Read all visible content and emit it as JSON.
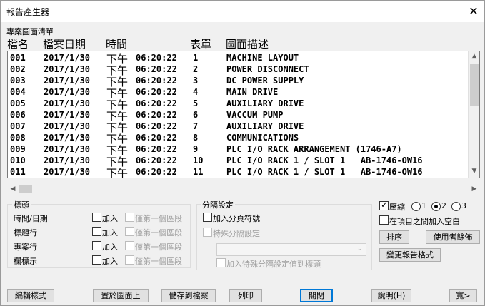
{
  "window": {
    "title": "報告產生器"
  },
  "list_section": {
    "label": "專案圖面清單",
    "columns": [
      "檔名",
      "檔案日期",
      "時間",
      "表單",
      "圖面描述"
    ],
    "rows": [
      {
        "file": "001",
        "date": "2017/1/30",
        "ampm": "下午",
        "time": "06:20:22",
        "sheet": "1",
        "desc": "MACHINE LAYOUT"
      },
      {
        "file": "002",
        "date": "2017/1/30",
        "ampm": "下午",
        "time": "06:20:22",
        "sheet": "2",
        "desc": "POWER DISCONNECT"
      },
      {
        "file": "003",
        "date": "2017/1/30",
        "ampm": "下午",
        "time": "06:20:22",
        "sheet": "3",
        "desc": "DC POWER SUPPLY"
      },
      {
        "file": "004",
        "date": "2017/1/30",
        "ampm": "下午",
        "time": "06:20:22",
        "sheet": "4",
        "desc": "MAIN DRIVE"
      },
      {
        "file": "005",
        "date": "2017/1/30",
        "ampm": "下午",
        "time": "06:20:22",
        "sheet": "5",
        "desc": "AUXILIARY DRIVE"
      },
      {
        "file": "006",
        "date": "2017/1/30",
        "ampm": "下午",
        "time": "06:20:22",
        "sheet": "6",
        "desc": "VACCUM PUMP"
      },
      {
        "file": "007",
        "date": "2017/1/30",
        "ampm": "下午",
        "time": "06:20:22",
        "sheet": "7",
        "desc": "AUXILIARY DRIVE"
      },
      {
        "file": "008",
        "date": "2017/1/30",
        "ampm": "下午",
        "time": "06:20:22",
        "sheet": "8",
        "desc": "COMMUNICATIONS"
      },
      {
        "file": "009",
        "date": "2017/1/30",
        "ampm": "下午",
        "time": "06:20:22",
        "sheet": "9",
        "desc": "PLC I/O RACK ARRANGEMENT (1746-A7)"
      },
      {
        "file": "010",
        "date": "2017/1/30",
        "ampm": "下午",
        "time": "06:20:22",
        "sheet": "10",
        "desc": "PLC I/O RACK 1 / SLOT 1   AB-1746-OW16"
      },
      {
        "file": "011",
        "date": "2017/1/30",
        "ampm": "下午",
        "time": "06:20:22",
        "sheet": "11",
        "desc": "PLC I/O RACK 1 / SLOT 1   AB-1746-OW16"
      }
    ]
  },
  "header_group": {
    "title": "標頭",
    "rows": [
      {
        "label": "時間/日期",
        "add": "加入",
        "first": "僅第一個區段"
      },
      {
        "label": "標題行",
        "add": "加入",
        "first": "僅第一個區段"
      },
      {
        "label": "專案行",
        "add": "加入",
        "first": "僅第一個區段"
      },
      {
        "label": "欄標示",
        "add": "加入",
        "first": "僅第一個區段"
      }
    ]
  },
  "separator_group": {
    "title": "分隔設定",
    "add_page_break": "加入分頁符號",
    "special_separator": "特殊分隔設定",
    "add_special_to_header": "加入特殊分隔設定值到標頭"
  },
  "right_panel": {
    "compress": "壓縮",
    "compress_checked": true,
    "radio_options": [
      "1",
      "2",
      "3"
    ],
    "radio_selected": "2",
    "blank_between": "在項目之間加入空白",
    "sort_button": "排序",
    "user_layout_button": "使用者餘佈",
    "change_format_button": "變更報告格式"
  },
  "bottom_buttons": {
    "edit_style": "編輯樣式",
    "place_on_drawing": "置於圖面上",
    "save_to_file": "儲存到檔案",
    "print": "列印",
    "close": "關閉",
    "help": "說明(H)",
    "wide": "寬>"
  },
  "icons": {
    "close": "close-icon",
    "scroll_up": "arrow-up-icon",
    "scroll_down": "arrow-down-icon",
    "scroll_left": "arrow-left-icon",
    "scroll_right": "arrow-right-icon",
    "dropdown": "chevron-down-icon"
  }
}
